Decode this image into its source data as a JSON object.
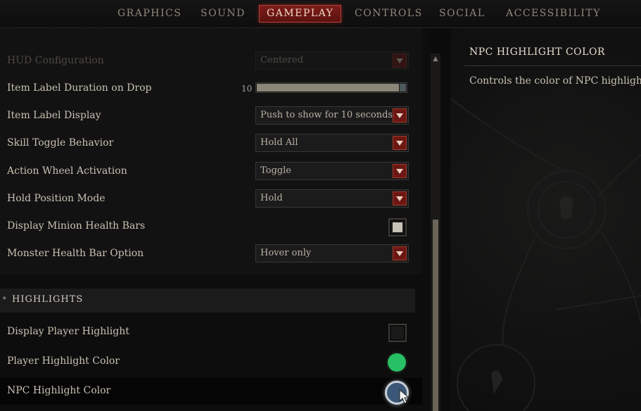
{
  "tabs": [
    {
      "label": "GRAPHICS",
      "active": false
    },
    {
      "label": "SOUND",
      "active": false
    },
    {
      "label": "GAMEPLAY",
      "active": true
    },
    {
      "label": "CONTROLS",
      "active": false
    },
    {
      "label": "SOCIAL",
      "active": false
    },
    {
      "label": "ACCESSIBILITY",
      "active": false
    }
  ],
  "settings": {
    "hud_configuration": {
      "label": "HUD Configuration",
      "value": "Centered",
      "disabled": true
    },
    "item_label_duration": {
      "label": "Item Label Duration on Drop",
      "value": "10",
      "fill": 1.0
    },
    "item_label_display": {
      "label": "Item Label Display",
      "value": "Push to show for 10 seconds"
    },
    "skill_toggle_behavior": {
      "label": "Skill Toggle Behavior",
      "value": "Hold All"
    },
    "action_wheel_activation": {
      "label": "Action Wheel Activation",
      "value": "Toggle"
    },
    "hold_position_mode": {
      "label": "Hold Position Mode",
      "value": "Hold"
    },
    "display_minion_health_bars": {
      "label": "Display Minion Health Bars",
      "checked": true
    },
    "monster_health_bar_option": {
      "label": "Monster Health Bar Option",
      "value": "Hover only"
    }
  },
  "highlights": {
    "section_title": "HIGHLIGHTS",
    "display_player_highlight": {
      "label": "Display Player Highlight",
      "checked": false
    },
    "player_highlight_color": {
      "label": "Player Highlight Color",
      "color": "#27c064"
    },
    "npc_highlight_color": {
      "label": "NPC Highlight Color",
      "color": "#3b5777"
    }
  },
  "info_panel": {
    "title": "NPC HIGHLIGHT COLOR",
    "description": "Controls the color of NPC highlights."
  },
  "colors": {
    "accent": "#7d1c18",
    "text": "#c9c1b3",
    "background": "#0d0d0d"
  }
}
